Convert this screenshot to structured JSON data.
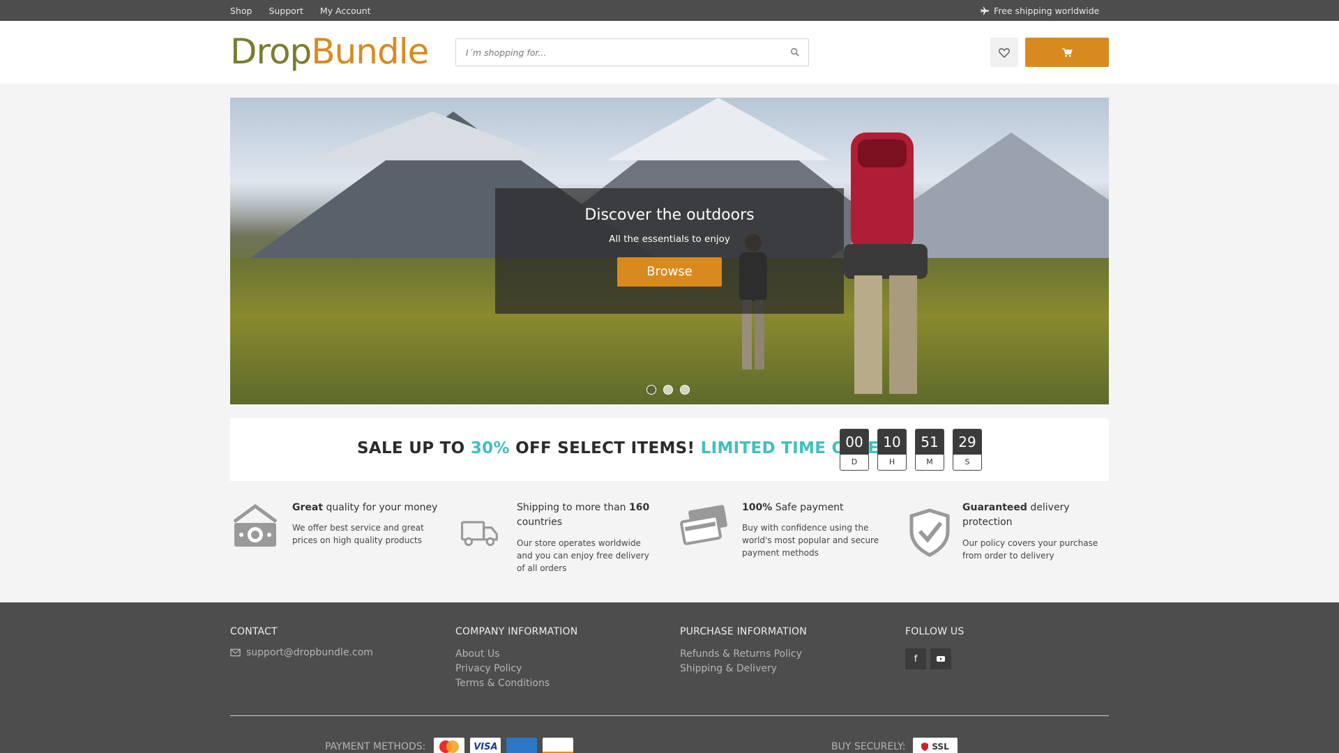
{
  "topbar": {
    "links": [
      "Shop",
      "Support",
      "My Account"
    ],
    "shipping_notice": "Free shipping worldwide"
  },
  "header": {
    "logo_part1": "Drop",
    "logo_part2": "Bundle",
    "search_placeholder": "I´m shopping for...",
    "icons": [
      "search-icon",
      "heart-icon",
      "cart-icon"
    ],
    "accent_color": "#d98a1f"
  },
  "hero": {
    "title": "Discover the outdoors",
    "subtitle": "All the essentials to enjoy",
    "button": "Browse",
    "slides": 3,
    "active_slide": 1
  },
  "sale": {
    "text_1": "SALE UP TO ",
    "highlight_1": "30%",
    "text_2": " OFF SELECT ITEMS! ",
    "highlight_2": "LIMITED TIME OFFER",
    "highlight_color": "#3fbfbf",
    "countdown": [
      {
        "value": "00",
        "unit": "D"
      },
      {
        "value": "10",
        "unit": "H"
      },
      {
        "value": "51",
        "unit": "M"
      },
      {
        "value": "29",
        "unit": "S"
      }
    ]
  },
  "features": [
    {
      "icon": "money-icon",
      "bold": "Great",
      "rest": " quality for your money",
      "desc": "We offer best service and great prices on high quality products"
    },
    {
      "icon": "truck-icon",
      "pre": "Shipping to more than ",
      "bold": "160",
      "post": " countries",
      "desc": "Our store operates worldwide and you can enjoy free delivery of all orders"
    },
    {
      "icon": "credit-card-icon",
      "bold": "100%",
      "rest": " Safe payment",
      "desc": "Buy with confidence using the world's most popular and secure payment methods"
    },
    {
      "icon": "shield-check-icon",
      "bold": "Guaranteed",
      "rest": " delivery protection",
      "desc": "Our policy covers your purchase from order to delivery"
    }
  ],
  "footer": {
    "contact": {
      "heading": "CONTACT",
      "email": "support@dropbundle.com"
    },
    "company": {
      "heading": "COMPANY INFORMATION",
      "links": [
        "About Us",
        "Privacy Policy",
        "Terms & Conditions"
      ]
    },
    "purchase": {
      "heading": "PURCHASE INFORMATION",
      "links": [
        "Refunds & Returns Policy",
        "Shipping & Delivery"
      ]
    },
    "follow": {
      "heading": "FOLLOW US",
      "icons": [
        "facebook-icon",
        "youtube-icon"
      ]
    },
    "payment_label": "PAYMENT METHODS:",
    "payment_cards": [
      "MasterCard",
      "VISA",
      "AMERICAN EXPRESS",
      "DISCOVER"
    ],
    "secure_label": "BUY SECURELY:",
    "ssl_badge": "SSL"
  }
}
